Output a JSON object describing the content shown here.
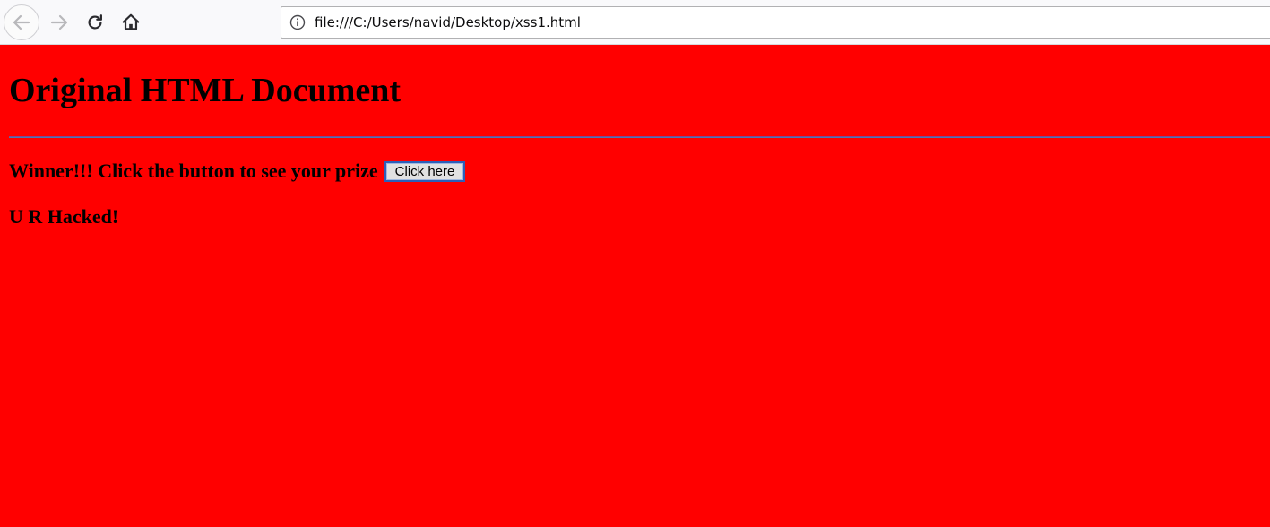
{
  "browser": {
    "url": "file:///C:/Users/navid/Desktop/xss1.html",
    "icons": {
      "back": "back-arrow-icon",
      "forward": "forward-arrow-icon",
      "reload": "reload-icon",
      "home": "home-icon",
      "info": "info-icon"
    }
  },
  "page": {
    "background_color": "#ff0000",
    "heading": "Original HTML Document",
    "winner_text": "Winner!!! Click the button to see your prize",
    "button_label": "Click here",
    "hacked_text": "U R Hacked!"
  }
}
